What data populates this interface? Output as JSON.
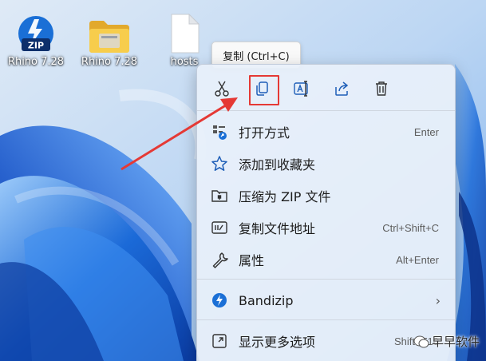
{
  "desktop": {
    "icons": [
      {
        "label": "Rhino 7.28",
        "type": "zip-archive"
      },
      {
        "label": "Rhino 7.28",
        "type": "folder"
      },
      {
        "label": "hosts",
        "type": "file"
      }
    ],
    "zip_badge_text": "ZIP"
  },
  "tooltip": {
    "text": "复制 (Ctrl+C)"
  },
  "context_menu": {
    "quick_actions": [
      {
        "name": "cut",
        "icon": "scissors-icon"
      },
      {
        "name": "copy",
        "icon": "copy-icon",
        "highlighted": true
      },
      {
        "name": "rename",
        "icon": "rename-icon"
      },
      {
        "name": "share",
        "icon": "share-icon"
      },
      {
        "name": "delete",
        "icon": "trash-icon"
      }
    ],
    "items": [
      {
        "label": "打开方式",
        "shortcut": "Enter",
        "icon": "open-with-icon"
      },
      {
        "label": "添加到收藏夹",
        "shortcut": "",
        "icon": "star-icon"
      },
      {
        "label": "压缩为 ZIP 文件",
        "shortcut": "",
        "icon": "zip-folder-icon"
      },
      {
        "label": "复制文件地址",
        "shortcut": "Ctrl+Shift+C",
        "icon": "copy-path-icon"
      },
      {
        "label": "属性",
        "shortcut": "Alt+Enter",
        "icon": "wrench-icon"
      },
      {
        "label": "Bandizip",
        "shortcut": "",
        "icon": "bandizip-icon",
        "submenu": true
      },
      {
        "label": "显示更多选项",
        "shortcut": "Shift+F10",
        "icon": "more-options-icon"
      }
    ]
  },
  "watermark": {
    "text": "早早软件"
  },
  "colors": {
    "accent": "#1a6fd6",
    "highlight_box": "#e53935",
    "arrow": "#e53935"
  }
}
